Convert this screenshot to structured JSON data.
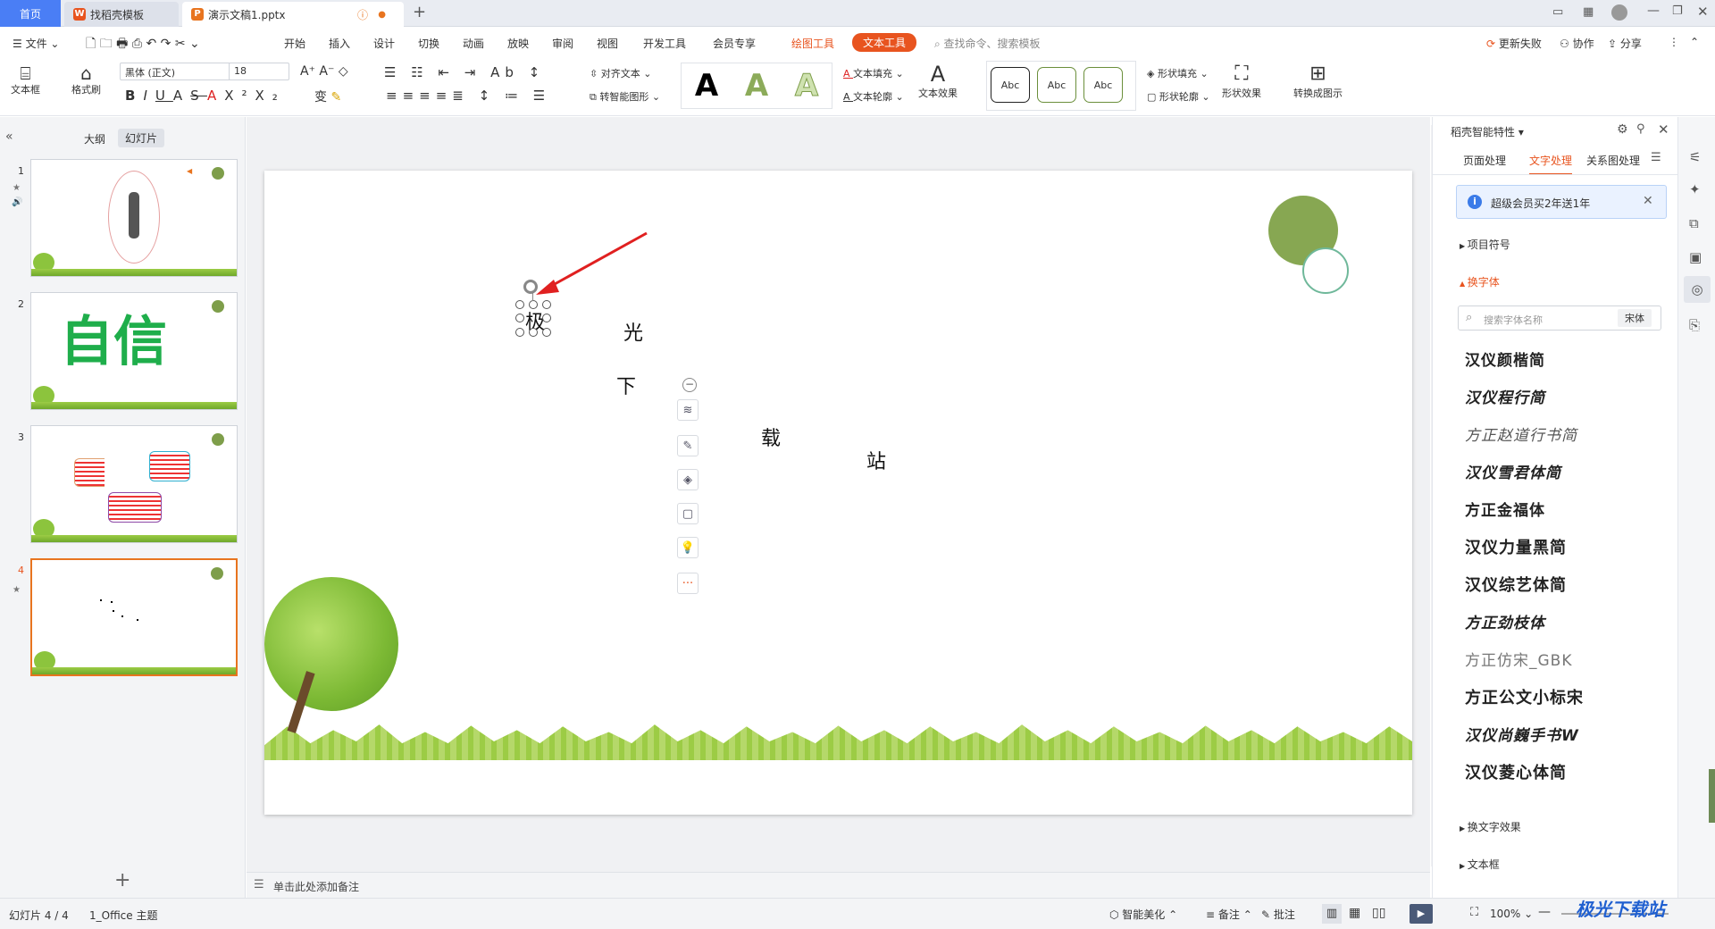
{
  "tabs": {
    "home": "首页",
    "docer": "找稻壳模板",
    "file": "演示文稿1.pptx"
  },
  "menu": {
    "file": "文件",
    "items": [
      "开始",
      "插入",
      "设计",
      "切换",
      "动画",
      "放映",
      "审阅",
      "视图",
      "开发工具",
      "会员专享"
    ],
    "drawing_tools": "绘图工具",
    "text_tools": "文本工具",
    "search": "查找命令、搜索模板",
    "update_failed": "更新失败",
    "collab": "协作",
    "share": "分享"
  },
  "toolbar": {
    "textbox": "文本框",
    "format_painter": "格式刷",
    "font_name": "黑体 (正文)",
    "font_size": "18",
    "align_text": "对齐文本",
    "smart_shape": "转智能图形",
    "text_fill": "文本填充",
    "text_outline": "文本轮廓",
    "text_effect": "文本效果",
    "style_sample": "Abc",
    "shape_fill": "形状填充",
    "shape_outline": "形状轮廓",
    "shape_effect": "形状效果",
    "convert_diagram": "转换成图示"
  },
  "left_panel": {
    "outline_tab": "大纲",
    "slides_tab": "幻灯片",
    "slide_numbers": [
      "1",
      "2",
      "3",
      "4"
    ],
    "slide2_text": "自信"
  },
  "slide": {
    "chars": {
      "ji": "极",
      "guang": "光",
      "xia": "下",
      "zai": "载",
      "zhan": "站"
    }
  },
  "notes": {
    "placeholder": "单击此处添加备注"
  },
  "right_panel": {
    "title": "稻壳智能特性",
    "tabs": [
      "页面处理",
      "文字处理",
      "关系图处理"
    ],
    "promo": "超级会员买2年送1年",
    "bullets": "项目符号",
    "change_font": "换字体",
    "font_search": "搜索字体名称",
    "font_current": "宋体",
    "fonts": [
      "汉仪颜楷简",
      "汉仪程行简",
      "方正赵道行书简",
      "汉仪雪君体简",
      "方正金福体",
      "汉仪力量黑简",
      "汉仪综艺体简",
      "方正劲枝体",
      "方正仿宋_GBK",
      "方正公文小标宋",
      "汉仪尚巍手书W",
      "汉仪菱心体简"
    ],
    "text_effects": "换文字效果",
    "textbox": "文本框"
  },
  "status": {
    "slide_count": "幻灯片 4 / 4",
    "theme": "1_Office 主题",
    "smart_beautify": "智能美化",
    "notes": "备注",
    "comments": "批注",
    "zoom": "100%"
  },
  "watermark": "极光下载站",
  "colors": {
    "accent": "#4a7ef5",
    "active": "#e8541f",
    "green": "#7e9e4a"
  }
}
